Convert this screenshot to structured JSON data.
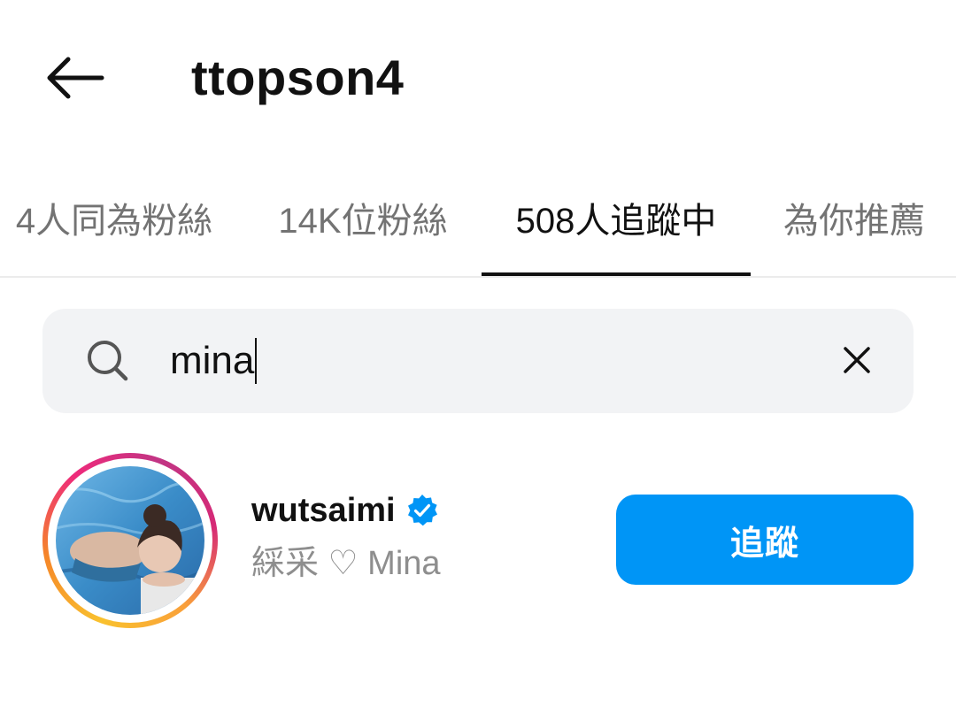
{
  "header": {
    "back_icon": "arrow-left-icon",
    "title": "ttopson4"
  },
  "tabs": [
    {
      "label": "4人同為粉絲",
      "active": false
    },
    {
      "label": "14K位粉絲",
      "active": false
    },
    {
      "label": "508人追蹤中",
      "active": true
    },
    {
      "label": "為你推薦",
      "active": false
    }
  ],
  "search": {
    "icon": "search-icon",
    "value": "mina",
    "clear_icon": "close-icon"
  },
  "results": [
    {
      "username": "wutsaimi",
      "verified": true,
      "verified_icon": "verified-badge-icon",
      "full_name": "綵采 ♡ Mina",
      "follow_label": "追蹤"
    }
  ],
  "colors": {
    "accent": "#0095f6",
    "text_primary": "#111111",
    "text_secondary": "#8e8e8e",
    "tab_inactive": "#737373",
    "search_bg": "#f2f3f5"
  }
}
